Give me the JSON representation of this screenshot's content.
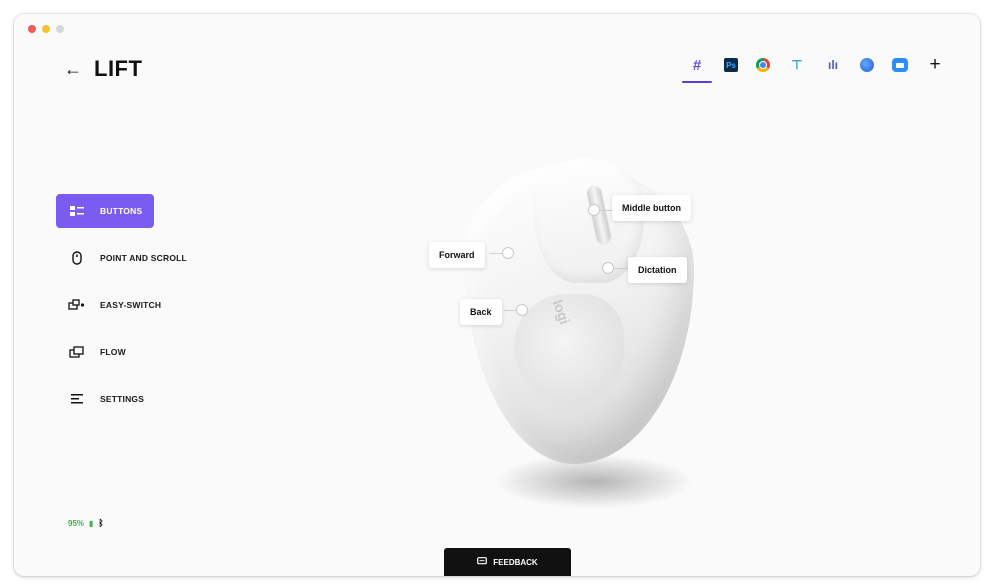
{
  "window": {
    "traffic_lights": [
      "close",
      "minimize",
      "zoom"
    ]
  },
  "header": {
    "back_arrow": "←",
    "device_name": "LIFT"
  },
  "app_bar": {
    "apps": [
      {
        "name": "all-applications-icon",
        "glyph": "#"
      },
      {
        "name": "photoshop-icon",
        "glyph": "Ps"
      },
      {
        "name": "chrome-icon",
        "glyph": ""
      },
      {
        "name": "app-tool-icon",
        "glyph": "⊤"
      },
      {
        "name": "teams-icon",
        "glyph": "ılı"
      },
      {
        "name": "globe-icon",
        "glyph": ""
      },
      {
        "name": "zoom-icon",
        "glyph": ""
      },
      {
        "name": "add-app-icon",
        "glyph": "+"
      }
    ],
    "active_index": 0
  },
  "nav": {
    "items": [
      {
        "label": "BUTTONS",
        "icon": "buttons-icon"
      },
      {
        "label": "POINT AND SCROLL",
        "icon": "mouse-icon"
      },
      {
        "label": "EASY-SWITCH",
        "icon": "easy-switch-icon"
      },
      {
        "label": "FLOW",
        "icon": "flow-icon"
      },
      {
        "label": "SETTINGS",
        "icon": "settings-icon"
      }
    ],
    "active_index": 0
  },
  "callouts": {
    "middle_button": "Middle button",
    "forward": "Forward",
    "dictation": "Dictation",
    "back": "Back"
  },
  "status": {
    "battery": "95%"
  },
  "footer": {
    "feedback_label": "FEEDBACK"
  },
  "colors": {
    "accent": "#7b5cf0",
    "battery_green": "#3cb34a"
  }
}
